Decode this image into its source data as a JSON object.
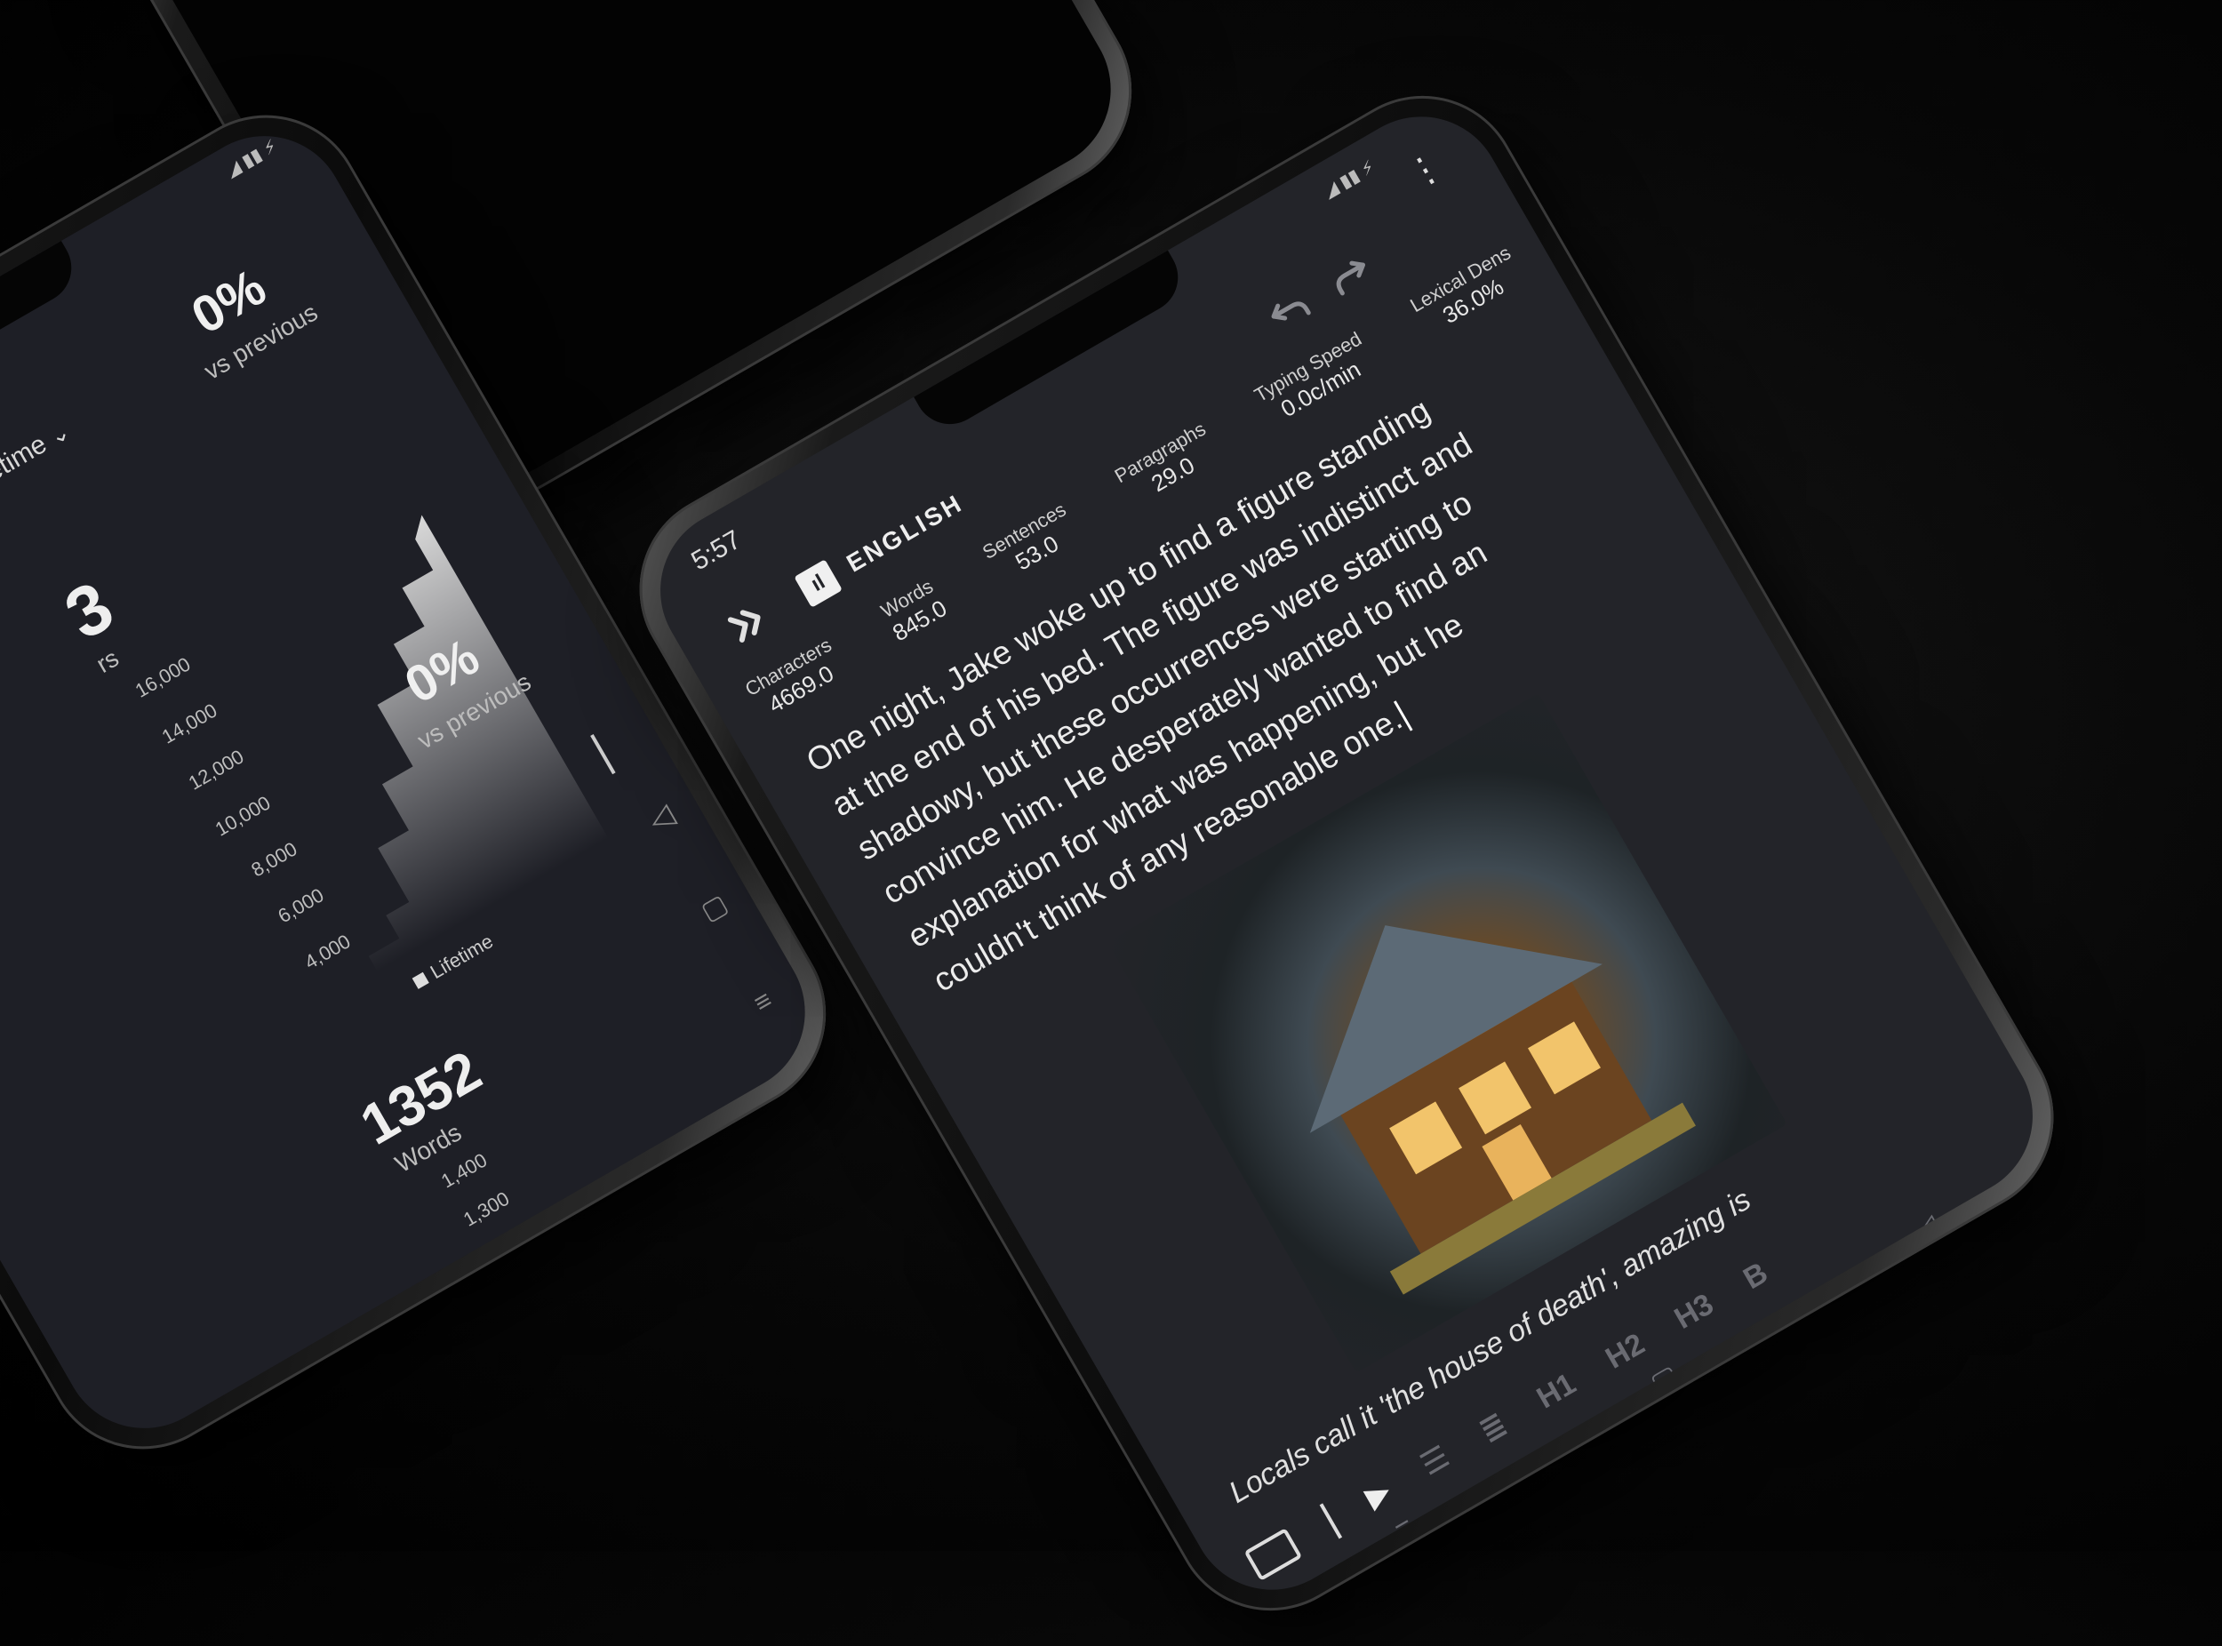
{
  "editor": {
    "status_time": "5:57",
    "language": "ENGLISH",
    "stats": [
      {
        "label": "Characters",
        "value": "4669.0"
      },
      {
        "label": "Words",
        "value": "845.0"
      },
      {
        "label": "Sentences",
        "value": "53.0"
      },
      {
        "label": "Paragraphs",
        "value": "29.0"
      },
      {
        "label": "Typing Speed",
        "value": "0.0c/min"
      },
      {
        "label": "Lexical Dens",
        "value": "36.0%"
      }
    ],
    "text_lines": [
      "One night, Jake woke up to find a figure standing",
      "at the end of his bed. The figure was indistinct and",
      "shadowy, but these occurrences were starting to",
      "convince him. He desperately wanted to find an",
      "explanation for what was happening, but he",
      "couldn't think of any reasonable one."
    ],
    "italic_line": "Locals call it 'the house of death', amazing is",
    "toolbar": {
      "bold": "B",
      "h3": "H3",
      "h2": "H2",
      "h1": "H1"
    }
  },
  "stats_screen": {
    "range_label": "etime",
    "pct_top": "0%",
    "vs_previous_top": "vs previous",
    "pct_mid": "0%",
    "vs_previous_mid": "vs previous",
    "partial_value": "3",
    "partial_label": "rs",
    "y_ticks": [
      "16,000",
      "14,000",
      "12,000",
      "10,000",
      "8,000",
      "6,000",
      "4,000"
    ],
    "legend": "Lifetime",
    "words_value": "1352",
    "words_label": "Words",
    "y_ticks_2": [
      "1,400",
      "1,300"
    ]
  },
  "colors": {
    "screen_bg": "#232429",
    "stats_bg": "#1e1f26",
    "text": "#ececec",
    "muted": "#6a6b72"
  }
}
